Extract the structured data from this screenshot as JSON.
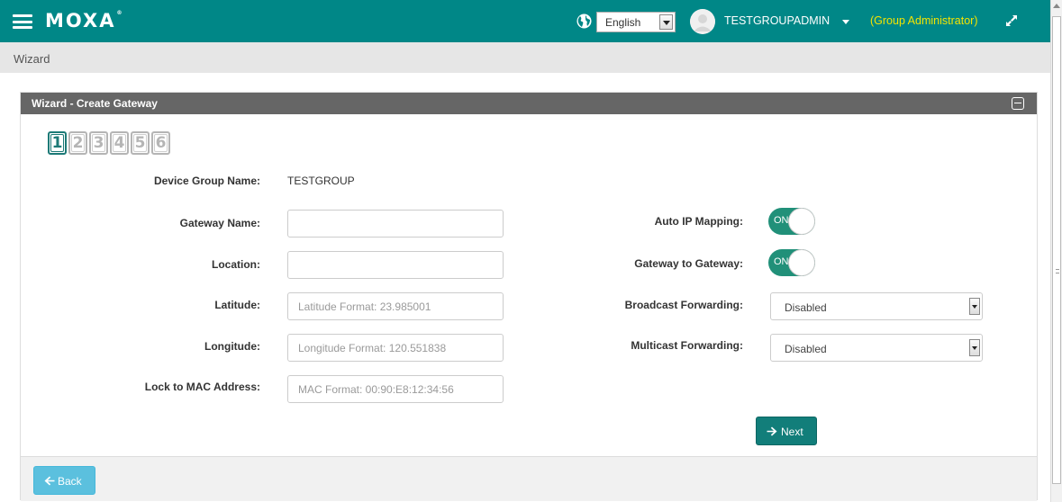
{
  "header": {
    "logo": "MOXA",
    "logo_mark": "®",
    "language": "English",
    "user_name": "TESTGROUPADMIN",
    "role": "(Group Administrator)",
    "icons": [
      "menu-icon",
      "globe-icon",
      "avatar-icon",
      "expand-icon"
    ]
  },
  "breadcrumb": "Wizard",
  "panel": {
    "title": "Wizard - Create Gateway",
    "steps": [
      "1",
      "2",
      "3",
      "4",
      "5",
      "6"
    ],
    "active_step": "1"
  },
  "form": {
    "device_group_label": "Device Group Name:",
    "device_group_value": "TESTGROUP",
    "gateway_name_label": "Gateway Name:",
    "gateway_name_value": "",
    "location_label": "Location:",
    "location_value": "",
    "latitude_label": "Latitude:",
    "latitude_placeholder": "Latitude Format: 23.985001",
    "longitude_label": "Longitude:",
    "longitude_placeholder": "Longitude Format: 120.551838",
    "mac_label": "Lock to MAC Address:",
    "mac_placeholder": "MAC Format: 00:90:E8:12:34:56",
    "auto_ip_label": "Auto IP Mapping:",
    "auto_ip_state": "ON",
    "g2g_label": "Gateway to Gateway:",
    "g2g_state": "ON",
    "broadcast_label": "Broadcast Forwarding:",
    "broadcast_value": "Disabled",
    "multicast_label": "Multicast Forwarding:",
    "multicast_value": "Disabled"
  },
  "buttons": {
    "next": "Next",
    "back": "Back"
  },
  "colors": {
    "header_bg": "#008787",
    "role_text": "#f4e400",
    "panel_head": "#666666",
    "toggle_on": "#219079",
    "next_button": "#127e7a",
    "back_button": "#5bc0de"
  }
}
